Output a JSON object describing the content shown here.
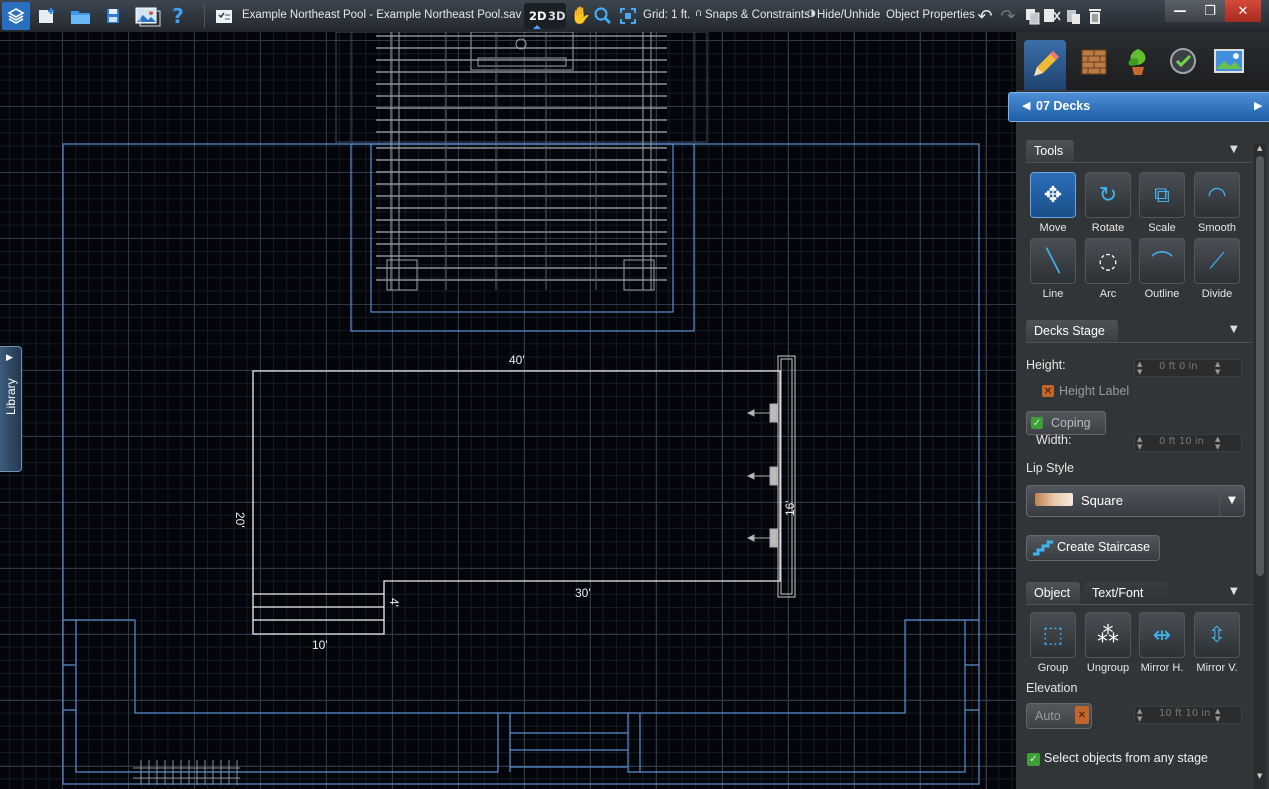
{
  "toolbar": {
    "view_2d": "2D",
    "view_3d": "3D",
    "file_title": "Example Northeast Pool - Example Northeast Pool.sav",
    "grid": "Grid: 1 ft.",
    "snaps": "Snaps & Constraints",
    "hide_unhide": "Hide/Unhide",
    "object_properties": "Object Properties",
    "icons": [
      "app-logo-icon",
      "new-file-icon",
      "open-folder-icon",
      "save-icon",
      "photo-icon",
      "help-icon",
      "checklist-icon",
      "hand-pan-icon",
      "zoom-icon",
      "fit-view-icon",
      "undo-icon",
      "redo-icon",
      "copy-icon",
      "cut-icon",
      "paste-icon",
      "delete-icon"
    ]
  },
  "window": {
    "minimize": "—",
    "maximize": "❐",
    "close": "✕"
  },
  "library": {
    "label": "Library"
  },
  "canvas": {
    "dimensions": {
      "top": "40'",
      "left": "20'",
      "right": "16'",
      "bottom": "30'",
      "step_width": "4'",
      "step_len": "10'"
    }
  },
  "panel": {
    "stage": "07 Decks",
    "tools_header": "Tools",
    "tools": [
      "Move",
      "Rotate",
      "Scale",
      "Smooth",
      "Line",
      "Arc",
      "Outline",
      "Divide"
    ],
    "decks_stage_header": "Decks Stage",
    "height_label": "Height:",
    "height_value": "0 ft  0 in",
    "height_label_toggle": "Height Label",
    "coping_label": "Coping",
    "width_label": "Width:",
    "width_value": "0 ft  10 in",
    "lip_style_label": "Lip Style",
    "lip_style_value": "Square",
    "create_staircase": "Create Staircase",
    "tab_object": "Object",
    "tab_text_font": "Text/Font",
    "object_tools": [
      "Group",
      "Ungroup",
      "Mirror H.",
      "Mirror V."
    ],
    "elevation_label": "Elevation",
    "elevation_auto": "Auto",
    "elevation_value": "10 ft  10 in",
    "select_any_stage": "Select objects from any stage"
  },
  "colors": {
    "accent": "#2f7fd6",
    "blueprint_line": "#5a8fd0",
    "check_green": "#45b14a"
  }
}
